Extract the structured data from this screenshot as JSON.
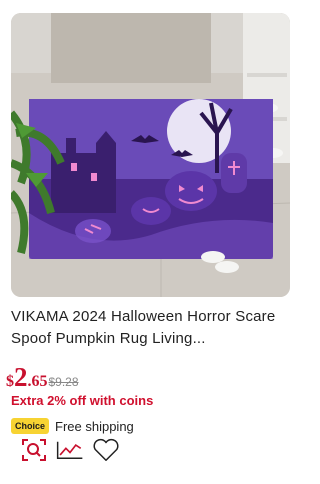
{
  "product": {
    "title": "VIKAMA 2024 Halloween Horror Scare Spoof Pumpkin Rug Living...",
    "image_icon": "product-image",
    "price": {
      "currency": "$",
      "integer": "2",
      "decimal": ".65",
      "original": "$9.28",
      "color": "#c8102e"
    },
    "coins_promo": "Extra 2% off with coins",
    "badge": "Choice",
    "badge_color": "#f7d332",
    "shipping": "Free shipping",
    "actions": [
      {
        "icon": "image-search-icon"
      },
      {
        "icon": "price-trend-icon"
      },
      {
        "icon": "heart-icon"
      }
    ]
  }
}
